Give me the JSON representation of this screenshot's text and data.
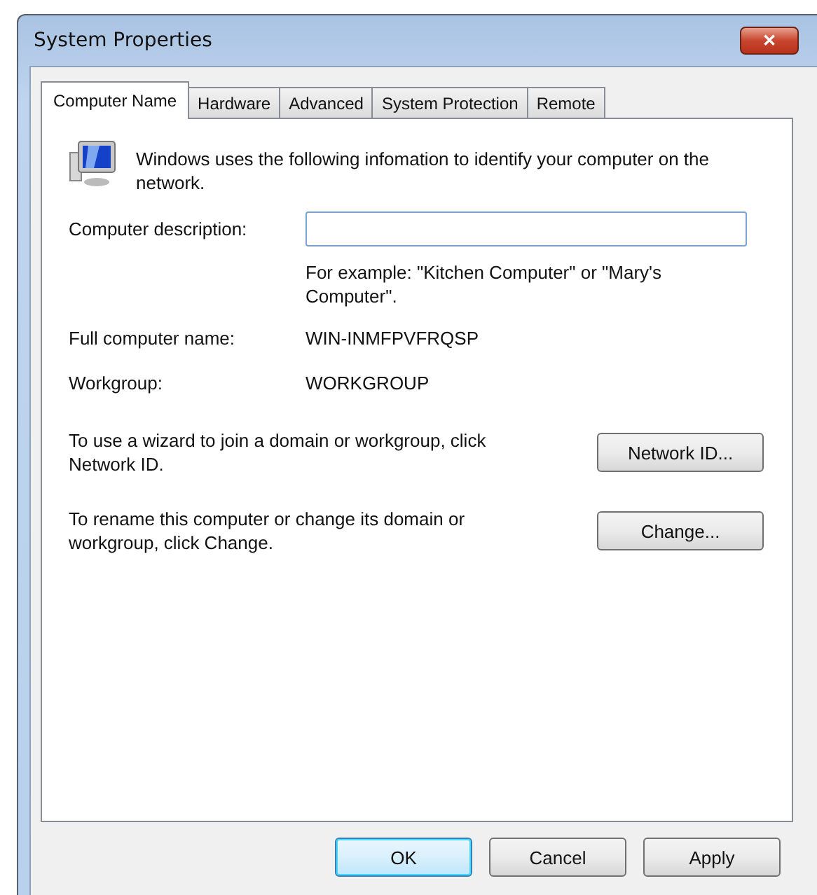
{
  "window": {
    "title": "System Properties",
    "close": "✕"
  },
  "tabs": [
    {
      "label": "Computer Name",
      "selected": true
    },
    {
      "label": "Hardware",
      "selected": false
    },
    {
      "label": "Advanced",
      "selected": false
    },
    {
      "label": "System Protection",
      "selected": false
    },
    {
      "label": "Remote",
      "selected": false
    }
  ],
  "intro": "Windows uses the following infomation to identify your computer on the network.",
  "description": {
    "label": "Computer description:",
    "focused": true,
    "hint": "For example: \"Kitchen Computer\" or \"Mary's Computer\"."
  },
  "fields": [
    {
      "label": "Full computer name:",
      "value": "WIN-INMFPVFRQSP"
    },
    {
      "label": "Workgroup:",
      "value": "WORKGROUP"
    }
  ],
  "actions": [
    {
      "text": "To use a wizard to join a domain or workgroup, click Network ID.",
      "button": "Network ID..."
    },
    {
      "text": "To rename this computer or change its domain or workgroup, click Change.",
      "button": "Change..."
    }
  ],
  "buttons": [
    {
      "label": "OK",
      "default": true
    },
    {
      "label": "Cancel",
      "default": false
    },
    {
      "label": "Apply",
      "default": false
    }
  ]
}
